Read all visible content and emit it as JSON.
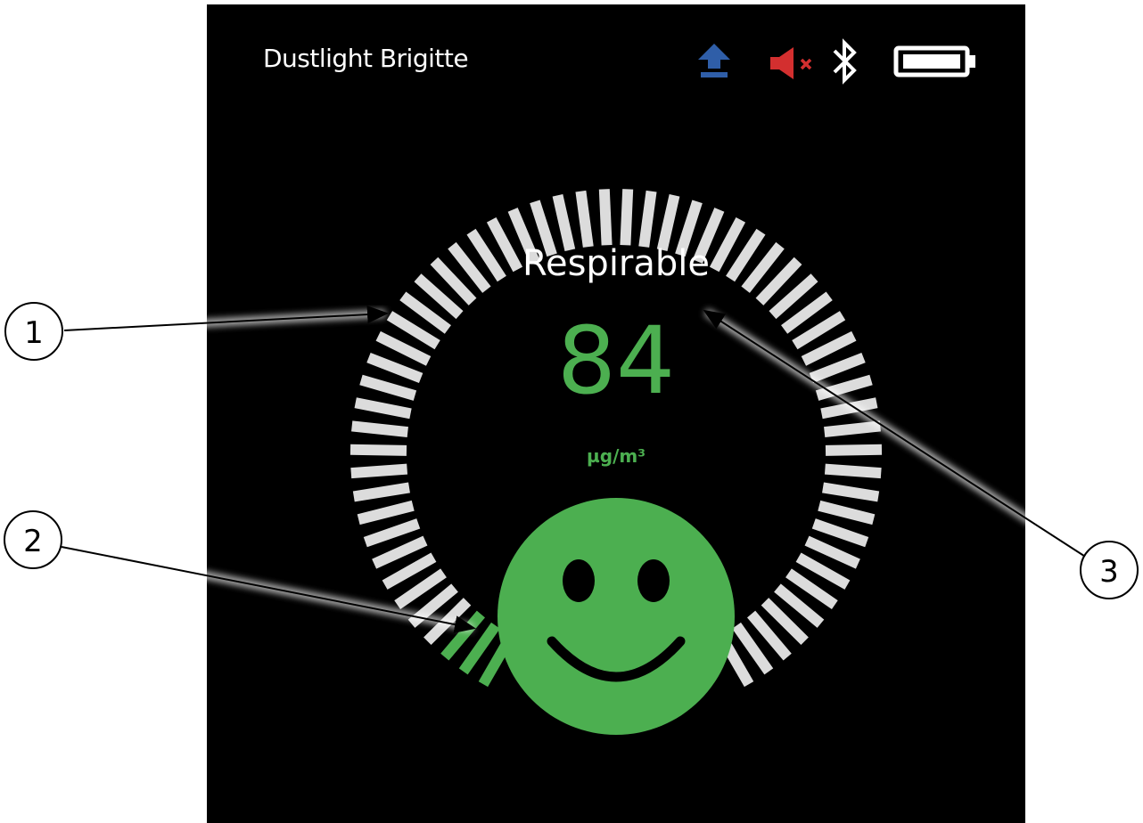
{
  "device": {
    "name": "Dustlight Brigitte"
  },
  "status_icons": [
    "upload-arrow-icon",
    "speaker-muted-icon",
    "bluetooth-icon",
    "battery-icon"
  ],
  "reading": {
    "label": "Respirable",
    "value": "84",
    "unit": "µg/m³",
    "level_segments_lit": 3,
    "level_segments_total": 60
  },
  "indicator": {
    "face": "smiley-face-icon"
  },
  "colors": {
    "screen_background": "#000000",
    "good_level": "#4caf50",
    "gauge_inactive": "#dcdcdc",
    "upload_icon": "#2f5ea8",
    "mute_icon": "#d32f2f"
  },
  "callouts": [
    {
      "number": "1"
    },
    {
      "number": "2"
    },
    {
      "number": "3"
    }
  ]
}
